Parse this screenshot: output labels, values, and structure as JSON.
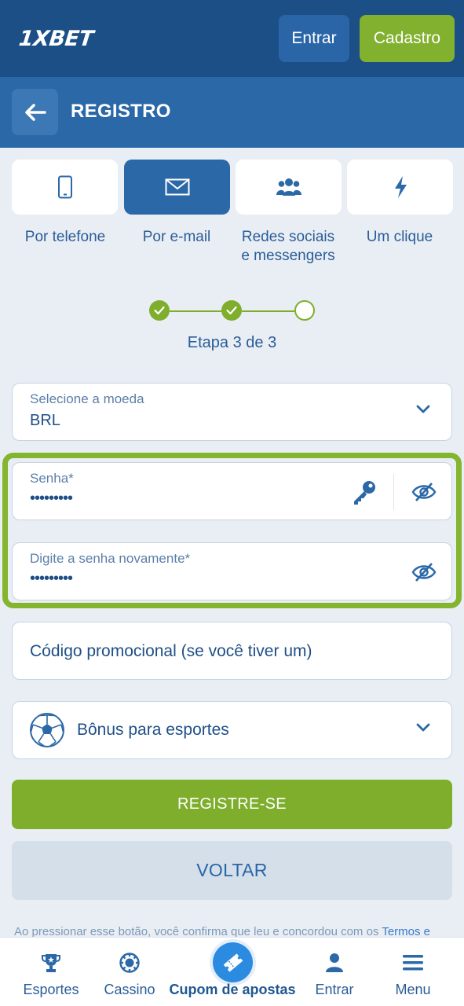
{
  "header": {
    "logo": "1XBET",
    "login_button": "Entrar",
    "signup_button": "Cadastro"
  },
  "titlebar": {
    "title": "REGISTRO"
  },
  "methods": [
    {
      "label": "Por telefone",
      "icon": "phone-icon",
      "active": false
    },
    {
      "label": "Por e-mail",
      "icon": "envelope-icon",
      "active": true
    },
    {
      "label_line1": "Redes sociais",
      "label_line2": "e messengers",
      "icon": "users-icon",
      "active": false
    },
    {
      "label": "Um clique",
      "icon": "lightning-icon",
      "active": false
    }
  ],
  "stepper": {
    "current": 3,
    "total": 3,
    "text": "Etapa 3 de 3"
  },
  "form": {
    "currency_label": "Selecione a moeda",
    "currency_value": "BRL",
    "password_label": "Senha*",
    "password_mask": "•••••••••",
    "confirm_label": "Digite a senha novamente*",
    "confirm_mask": "•••••••••",
    "promo_placeholder": "Código promocional (se você tiver um)",
    "bonus_label": "Bônus para esportes"
  },
  "actions": {
    "register": "REGISTRE-SE",
    "back": "VOLTAR"
  },
  "disclaimer": {
    "text": "Ao pressionar esse botão, você confirma que leu e concordou com os ",
    "link": "Termos e"
  },
  "bottom_nav": {
    "sports": "Esportes",
    "casino": "Cassino",
    "coupon": "Cupom de apostas",
    "login": "Entrar",
    "menu": "Menu"
  },
  "colors": {
    "header_bg": "#1c4f86",
    "titlebar_bg": "#2b68a8",
    "accent_green": "#7eae2c",
    "page_bg": "#e9eef4"
  }
}
